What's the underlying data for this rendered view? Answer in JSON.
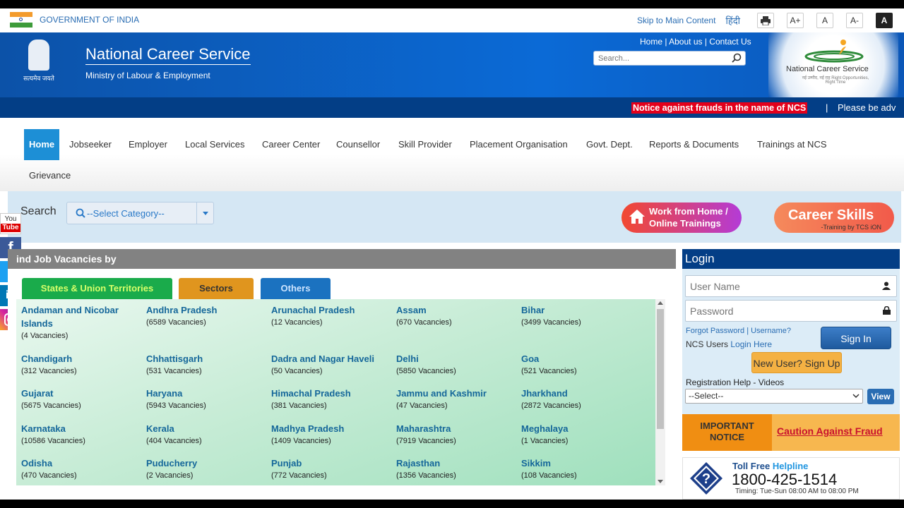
{
  "gov_bar": {
    "text": "GOVERNMENT OF INDIA",
    "skip": "Skip to Main Content",
    "hindi": "हिंदी",
    "font_large": "A+",
    "font_normal": "A",
    "font_small": "A-",
    "contrast": "A"
  },
  "header": {
    "title": "National Career Service",
    "ministry": "Ministry of Labour & Employment",
    "emblem_motto": "सत्यमेव जयते",
    "toplinks": "Home | About us | Contact Us",
    "search_placeholder": "Search...",
    "logo_text": "National Career Service",
    "logo_subtext": "नई उम्मीद, नई राह Right Opportunities, Right Time"
  },
  "notice": {
    "red": "Notice against frauds in the name of NCS",
    "sep": "|",
    "adv": "Please be adv"
  },
  "nav": {
    "items": [
      "Home",
      "Jobseeker",
      "Employer",
      "Local Services",
      "Career Center",
      "Counsellor",
      "Skill Provider",
      "Placement Organisation",
      "Govt. Dept.",
      "Reports & Documents",
      "Trainings at NCS"
    ],
    "grievance": "Grievance"
  },
  "search_band": {
    "label": "Search",
    "category": "--Select Category--",
    "wfh_line1": "Work from Home /",
    "wfh_line2": "Online Trainings",
    "career_title": "Career Skills",
    "career_sub": "-Training by TCS iON"
  },
  "jobs": {
    "heading": "ind Job Vacancies by",
    "tabs": [
      "States & Union Territories",
      "Sectors",
      "Others"
    ],
    "states": [
      {
        "name": "Andaman and Nicobar Islands",
        "count": "(4 Vacancies)"
      },
      {
        "name": "Andhra Pradesh",
        "count": "(6589 Vacancies)"
      },
      {
        "name": "Arunachal Pradesh",
        "count": "(12 Vacancies)"
      },
      {
        "name": "Assam",
        "count": "(670 Vacancies)"
      },
      {
        "name": "Bihar",
        "count": "(3499 Vacancies)"
      },
      {
        "name": "Chandigarh",
        "count": "(312 Vacancies)"
      },
      {
        "name": "Chhattisgarh",
        "count": "(531 Vacancies)"
      },
      {
        "name": "Dadra and Nagar Haveli",
        "count": "(50 Vacancies)"
      },
      {
        "name": "Delhi",
        "count": "(5850 Vacancies)"
      },
      {
        "name": "Goa",
        "count": "(521 Vacancies)"
      },
      {
        "name": "Gujarat",
        "count": "(5675 Vacancies)"
      },
      {
        "name": "Haryana",
        "count": "(5943 Vacancies)"
      },
      {
        "name": "Himachal Pradesh",
        "count": "(381 Vacancies)"
      },
      {
        "name": "Jammu and Kashmir",
        "count": "(47 Vacancies)"
      },
      {
        "name": "Jharkhand",
        "count": "(2872 Vacancies)"
      },
      {
        "name": "Karnataka",
        "count": "(10586 Vacancies)"
      },
      {
        "name": "Kerala",
        "count": "(404 Vacancies)"
      },
      {
        "name": "Madhya Pradesh",
        "count": "(1409 Vacancies)"
      },
      {
        "name": "Maharashtra",
        "count": "(7919 Vacancies)"
      },
      {
        "name": "Meghalaya",
        "count": "(1 Vacancies)"
      },
      {
        "name": "Odisha",
        "count": "(470 Vacancies)"
      },
      {
        "name": "Puducherry",
        "count": "(2 Vacancies)"
      },
      {
        "name": "Punjab",
        "count": "(772 Vacancies)"
      },
      {
        "name": "Rajasthan",
        "count": "(1356 Vacancies)"
      },
      {
        "name": "Sikkim",
        "count": "(108 Vacancies)"
      }
    ]
  },
  "login": {
    "heading": "Login",
    "username_placeholder": "User Name",
    "password_placeholder": "Password",
    "forgot": "Forgot Password | Username?",
    "ncs_users": "NCS Users",
    "login_here": "Login Here",
    "sign_in": "Sign In",
    "new_user": "New User? Sign Up",
    "reg_help": "Registration Help - Videos",
    "reg_select": "--Select--",
    "view": "View"
  },
  "important": {
    "left": "IMPORTANT NOTICE",
    "right": "Caution Against Fraud"
  },
  "toll": {
    "label1": "Toll Free",
    "label2": "Helpline",
    "number": "1800-425-1514",
    "timing": "Timing: Tue-Sun 08:00 AM to 08:00 PM"
  },
  "social": {
    "youtube_line1": "You",
    "youtube_line2": "Tube",
    "facebook": "f",
    "twitter": "t",
    "linkedin": "in"
  }
}
